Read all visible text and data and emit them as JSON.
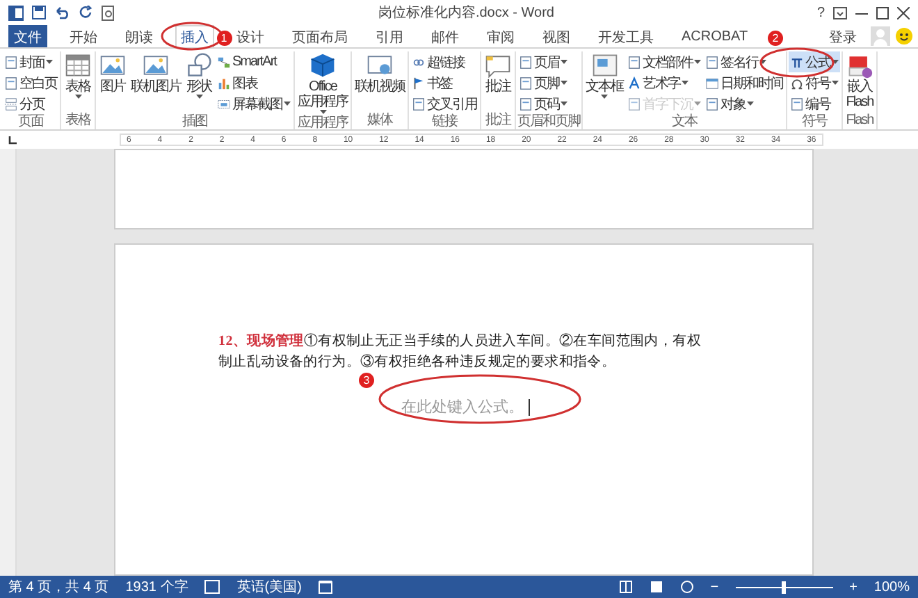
{
  "window": {
    "title": "岗位标准化内容.docx - Word",
    "help": "?",
    "sign_in": "登录"
  },
  "tabs": [
    {
      "label": "文件",
      "kind": "file",
      "selected": false
    },
    {
      "label": "开始",
      "kind": "tab",
      "selected": false
    },
    {
      "label": "朗读",
      "kind": "tab",
      "selected": false
    },
    {
      "label": "插入",
      "kind": "tab",
      "selected": true
    },
    {
      "label": "设计",
      "kind": "tab",
      "selected": false
    },
    {
      "label": "页面布局",
      "kind": "tab",
      "selected": false
    },
    {
      "label": "引用",
      "kind": "tab",
      "selected": false
    },
    {
      "label": "邮件",
      "kind": "tab",
      "selected": false
    },
    {
      "label": "审阅",
      "kind": "tab",
      "selected": false
    },
    {
      "label": "视图",
      "kind": "tab",
      "selected": false
    },
    {
      "label": "开发工具",
      "kind": "tab",
      "selected": false
    },
    {
      "label": "ACROBAT",
      "kind": "tab",
      "selected": false
    }
  ],
  "ribbon": [
    {
      "name": "页面",
      "items": [
        {
          "label": "封面",
          "kind": "small",
          "dropdown": true
        },
        {
          "label": "空白页",
          "kind": "small",
          "dropdown": false
        },
        {
          "label": "分页",
          "kind": "small",
          "dropdown": false
        }
      ]
    },
    {
      "name": "表格",
      "items": [
        {
          "label": "表格",
          "kind": "large",
          "dropdown": true
        }
      ]
    },
    {
      "name": "插图",
      "items": [
        {
          "label": "图片",
          "kind": "large",
          "dropdown": false
        },
        {
          "label": "联机图片",
          "kind": "large",
          "dropdown": false
        },
        {
          "label": "形状",
          "kind": "large",
          "dropdown": true
        },
        {
          "label": "SmartArt",
          "kind": "small",
          "dropdown": false
        },
        {
          "label": "图表",
          "kind": "small",
          "dropdown": false
        },
        {
          "label": "屏幕截图",
          "kind": "small",
          "dropdown": true
        }
      ]
    },
    {
      "name": "应用程序",
      "items": [
        {
          "label": "Office 应用程序",
          "kind": "large",
          "dropdown": true
        }
      ]
    },
    {
      "name": "媒体",
      "items": [
        {
          "label": "联机视频",
          "kind": "large",
          "dropdown": false
        }
      ]
    },
    {
      "name": "链接",
      "items": [
        {
          "label": "超链接",
          "kind": "small",
          "dropdown": false
        },
        {
          "label": "书签",
          "kind": "small",
          "dropdown": false
        },
        {
          "label": "交叉引用",
          "kind": "small",
          "dropdown": false
        }
      ]
    },
    {
      "name": "批注",
      "items": [
        {
          "label": "批注",
          "kind": "large",
          "dropdown": false
        }
      ]
    },
    {
      "name": "页眉和页脚",
      "items": [
        {
          "label": "页眉",
          "kind": "small",
          "dropdown": true
        },
        {
          "label": "页脚",
          "kind": "small",
          "dropdown": true
        },
        {
          "label": "页码",
          "kind": "small",
          "dropdown": true
        }
      ]
    },
    {
      "name": "文本",
      "items": [
        {
          "label": "文本框",
          "kind": "large",
          "dropdown": true,
          "disabled": false
        },
        {
          "label": "文档部件",
          "kind": "small",
          "dropdown": true,
          "disabled": false
        },
        {
          "label": "艺术字",
          "kind": "small",
          "dropdown": true,
          "disabled": false
        },
        {
          "label": "首字下沉",
          "kind": "small",
          "dropdown": true,
          "disabled": true
        },
        {
          "label": "签名行",
          "kind": "small",
          "dropdown": true,
          "disabled": false
        },
        {
          "label": "日期和时间",
          "kind": "small",
          "dropdown": false,
          "disabled": false
        },
        {
          "label": "对象",
          "kind": "small",
          "dropdown": true,
          "disabled": false
        }
      ]
    },
    {
      "name": "符号",
      "items": [
        {
          "label": "公式",
          "kind": "small",
          "dropdown": true,
          "selected": true
        },
        {
          "label": "符号",
          "kind": "small",
          "dropdown": true,
          "selected": false
        },
        {
          "label": "编号",
          "kind": "small",
          "dropdown": false,
          "selected": false
        }
      ]
    },
    {
      "name": "Flash",
      "items": [
        {
          "label": "嵌入 Flash",
          "kind": "large",
          "dropdown": false
        }
      ]
    }
  ],
  "ruler": [
    "6",
    "4",
    "2",
    "2",
    "4",
    "6",
    "8",
    "10",
    "12",
    "14",
    "16",
    "18",
    "20",
    "22",
    "24",
    "26",
    "28",
    "30",
    "32",
    "34",
    "36"
  ],
  "document": {
    "paragraph": "**12、现场管理**①有权制止无正当手续的人员进入车间。②在车间范围内，有权制止乱动设备的行为。③有权拒绝各种违反规定的要求和指令。",
    "equation_placeholder": "在此处键入公式。"
  },
  "annotations": [
    "1",
    "2",
    "3"
  ],
  "status_bar": {
    "page": "第 4 页，共 4 页",
    "words": "1931 个字",
    "language": "英语(美国)",
    "zoom_minus": "−",
    "zoom_plus": "+",
    "zoom_slider": {
      "level": 0.5
    },
    "zoom": "100%"
  }
}
